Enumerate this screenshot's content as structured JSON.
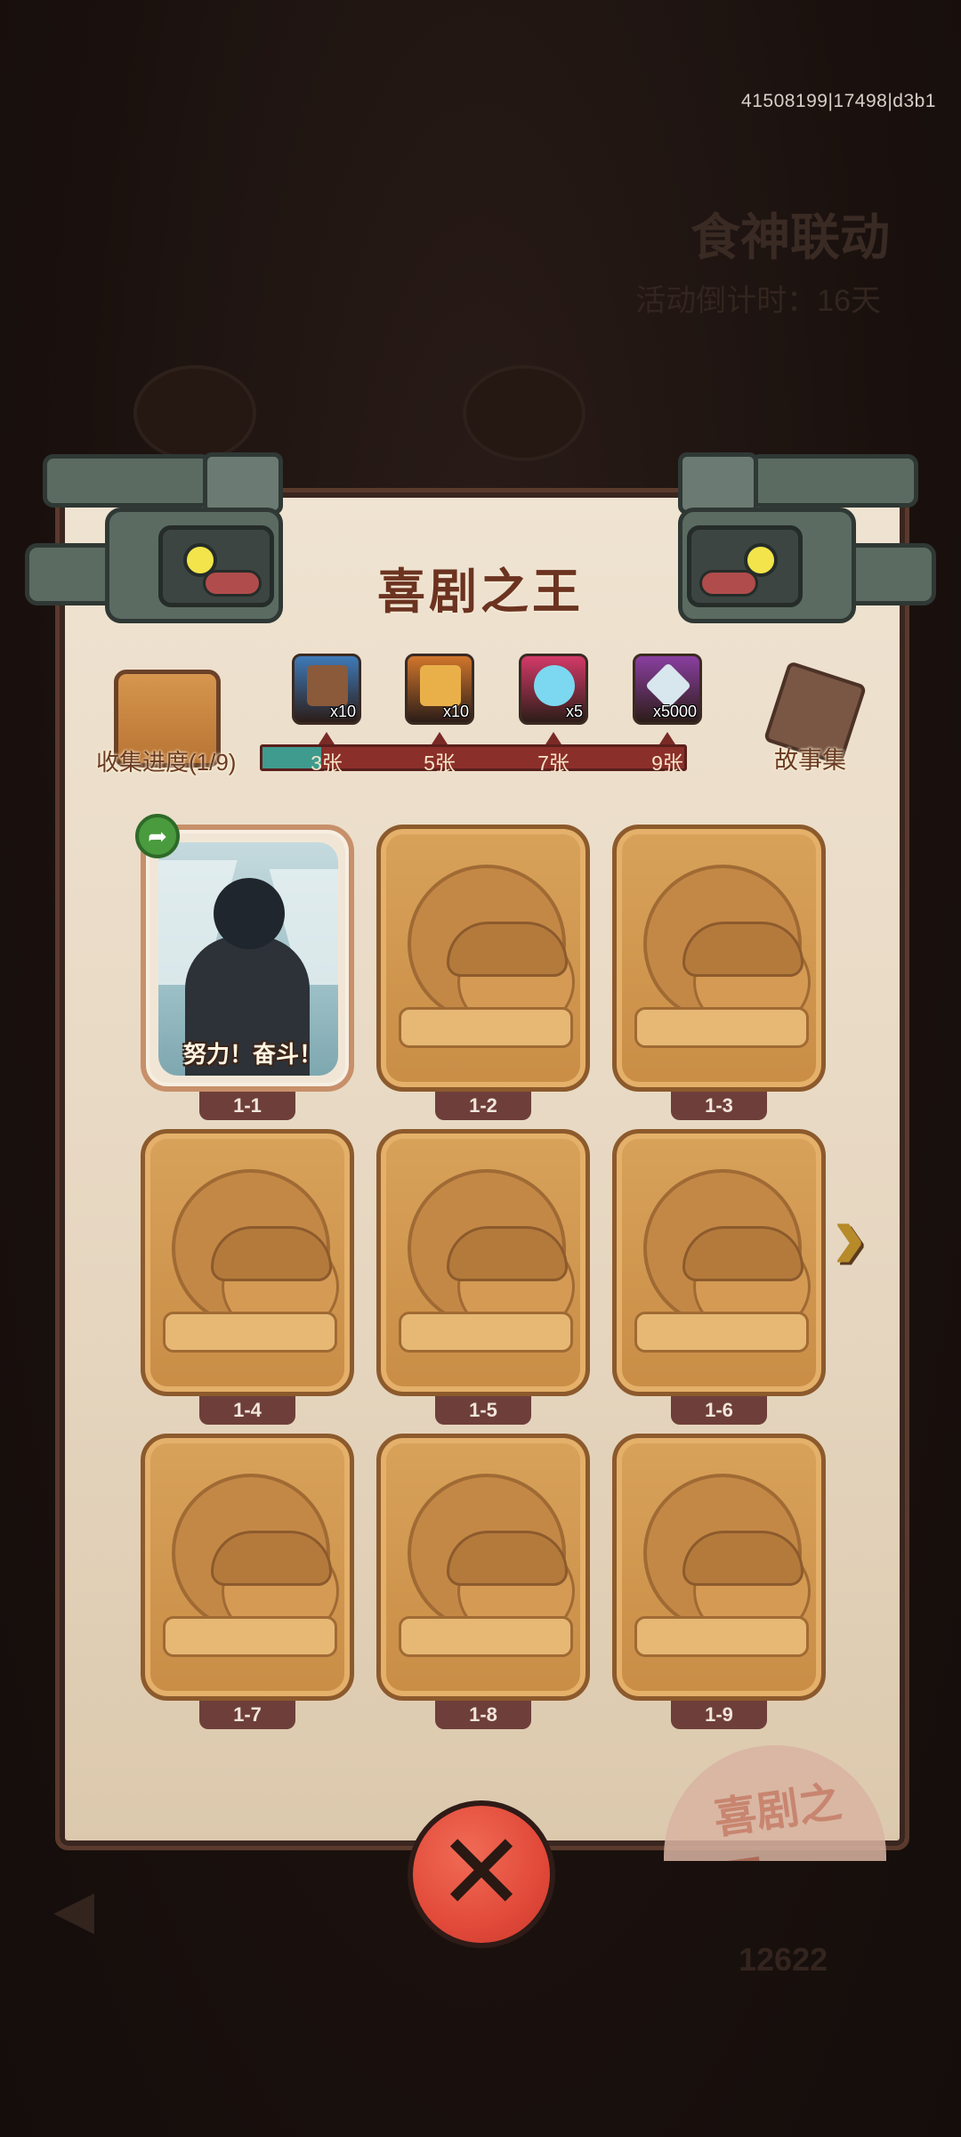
{
  "debug_id": "41508199|17498|d3b1",
  "background": {
    "title": "食神联动",
    "countdown": "活动倒计时：16天",
    "number": "12622"
  },
  "panel": {
    "title": "喜剧之王",
    "collect_label": "收集进度(1/9)",
    "story_label": "故事集",
    "progress": {
      "collected": 1,
      "total": 9
    },
    "seal_text": "喜剧之王"
  },
  "rewards": [
    {
      "count": "x10",
      "tier": "3张",
      "color": "#3e7ab8",
      "icon": "treasure-chest-icon"
    },
    {
      "count": "x10",
      "tier": "5张",
      "color": "#d0762c",
      "icon": "scroll-ticket-icon"
    },
    {
      "count": "x5",
      "tier": "7张",
      "color": "#d33a68",
      "icon": "magic-orb-icon"
    },
    {
      "count": "x5000",
      "tier": "9张",
      "color": "#8a3fa0",
      "icon": "crystal-icon"
    }
  ],
  "cards": [
    {
      "label": "1-1",
      "unlocked": true,
      "caption": "努力！奋斗！"
    },
    {
      "label": "1-2",
      "unlocked": false
    },
    {
      "label": "1-3",
      "unlocked": false
    },
    {
      "label": "1-4",
      "unlocked": false
    },
    {
      "label": "1-5",
      "unlocked": false
    },
    {
      "label": "1-6",
      "unlocked": false
    },
    {
      "label": "1-7",
      "unlocked": false
    },
    {
      "label": "1-8",
      "unlocked": false
    },
    {
      "label": "1-9",
      "unlocked": false
    }
  ],
  "icons": {
    "share": "share-icon",
    "next": "next-page-arrow-icon",
    "close": "close-icon"
  }
}
